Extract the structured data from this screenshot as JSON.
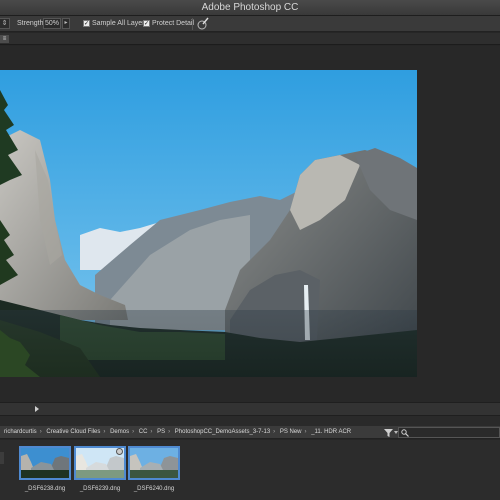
{
  "window": {
    "title": "Adobe Photoshop CC"
  },
  "options_bar": {
    "tool_menu_glyph": "⇕",
    "strength_label": "Strength:",
    "strength_value": "50%",
    "strength_arrow": "▸",
    "sample_all_layers": {
      "label": "Sample All Layers",
      "checked": true,
      "mark": "✓"
    },
    "protect_detail": {
      "label": "Protect Detail",
      "checked": true,
      "mark": "✓"
    },
    "icons": [
      "brush-pressure-icon"
    ]
  },
  "tab_bar": {
    "tab_glyph": "≡"
  },
  "document": {
    "sky_color": "#3aa3e0"
  },
  "bridge": {
    "path": [
      "richardcurtis",
      "Creative Cloud Files",
      "Demos",
      "CC",
      "PS",
      "PhotoshopCC_DemoAssets_3-7-13",
      "PS New",
      "_11. HDR ACR"
    ],
    "path_separator": "›",
    "icons": [
      "filter-icon",
      "search-icon"
    ],
    "accent_color": "#4f8ad1",
    "thumbnails": [
      {
        "filename": "_DSF6238.dng",
        "selected": true
      },
      {
        "filename": "_DSF6239.dng",
        "selected": true
      },
      {
        "filename": "_DSF6240.dng",
        "selected": true
      }
    ]
  }
}
